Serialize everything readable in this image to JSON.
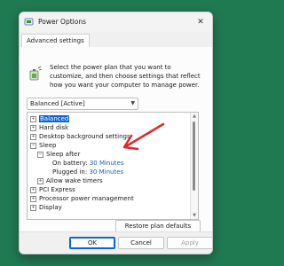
{
  "window": {
    "title": "Power Options",
    "close_glyph": "✕",
    "app_icon": "power-options-icon"
  },
  "tabs": [
    {
      "label": "Advanced settings",
      "active": true
    }
  ],
  "description": "Select the power plan that you want to customize, and then choose settings that reflect how you want your computer to manage power.",
  "plan_select": {
    "selected": "Balanced [Active]"
  },
  "tree": {
    "rows": [
      {
        "toggle": "⊞",
        "label": "Balanced",
        "selected": true
      },
      {
        "toggle": "⊞",
        "label": "Hard disk"
      },
      {
        "toggle": "⊞",
        "label": "Desktop background settings"
      },
      {
        "toggle": "⊟",
        "label": "Sleep"
      },
      {
        "toggle": "⊟",
        "label": "Sleep after"
      },
      {
        "label": "On battery:",
        "value": "30 Minutes"
      },
      {
        "label": "Plugged in:",
        "value": "30 Minutes"
      },
      {
        "toggle": "⊞",
        "label": "Allow wake timers"
      },
      {
        "toggle": "⊞",
        "label": "PCI Express"
      },
      {
        "toggle": "⊞",
        "label": "Processor power management"
      },
      {
        "toggle": "⊞",
        "label": "Display"
      }
    ]
  },
  "buttons": {
    "restore": "Restore plan defaults",
    "ok": "OK",
    "cancel": "Cancel",
    "apply": "Apply"
  },
  "colors": {
    "accent": "#0a64d8",
    "link_value": "#1f5fb0",
    "annotation_arrow": "#e0282d",
    "desktop": "#1f7a52"
  }
}
